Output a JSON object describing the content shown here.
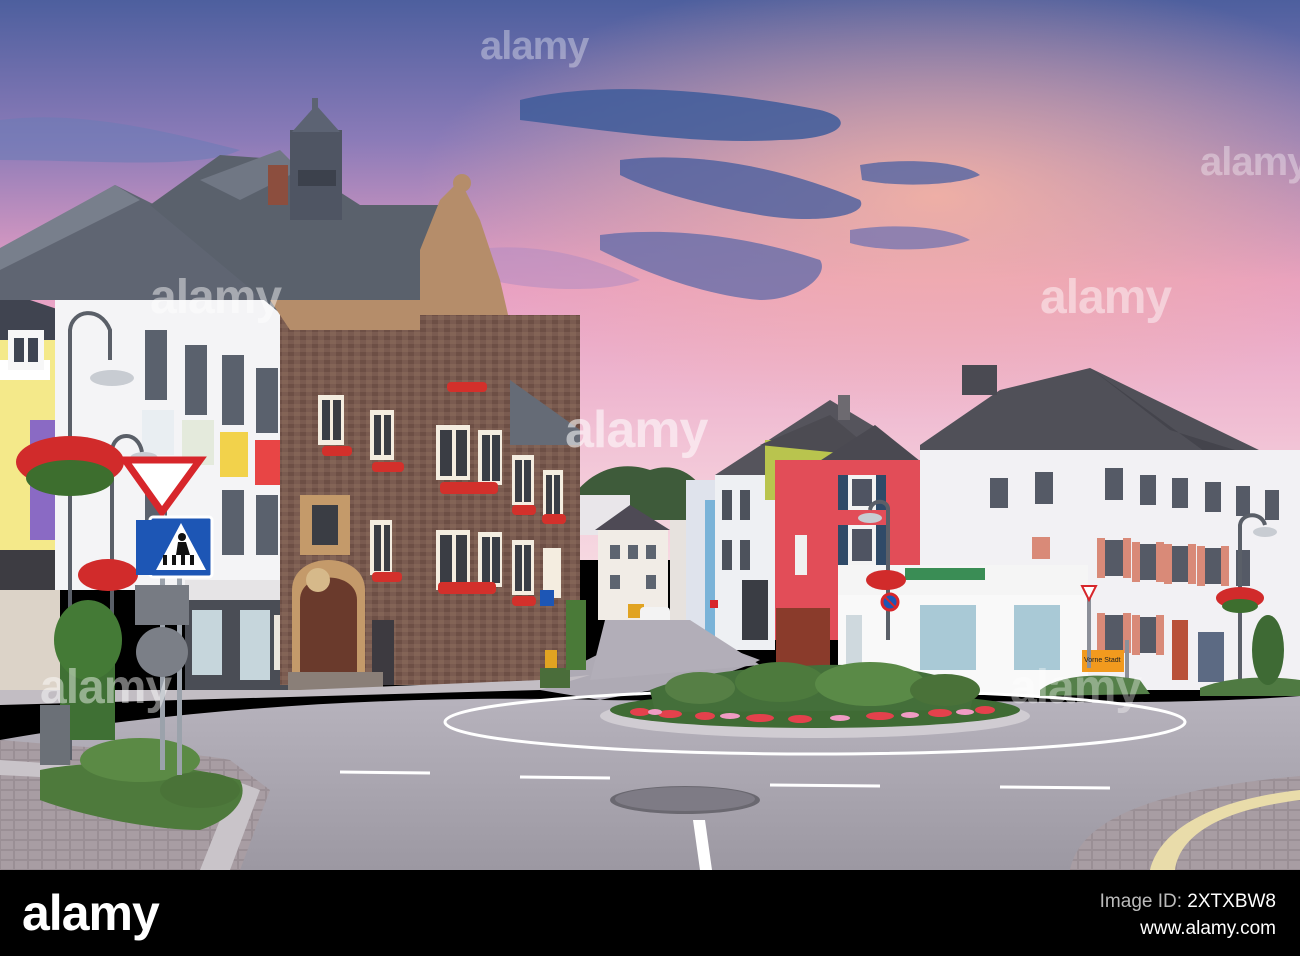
{
  "watermark": {
    "text": "alamy"
  },
  "footer": {
    "logo": "alamy",
    "image_id_label": "Image ID:",
    "image_id": "2XTXBW8",
    "url": "www.alamy.com"
  },
  "colors": {
    "sky_top": "#5a6fae",
    "sky_pink": "#e89bc0",
    "sky_horizon": "#f3c9d9",
    "road": "#a7a3ae",
    "stone_facade": "#7b5a4f",
    "pink_house": "#e4505a",
    "white_house": "#f1f0f3"
  },
  "signs": {
    "direction_sign": "Vorne Stadt → Bernkastel"
  }
}
